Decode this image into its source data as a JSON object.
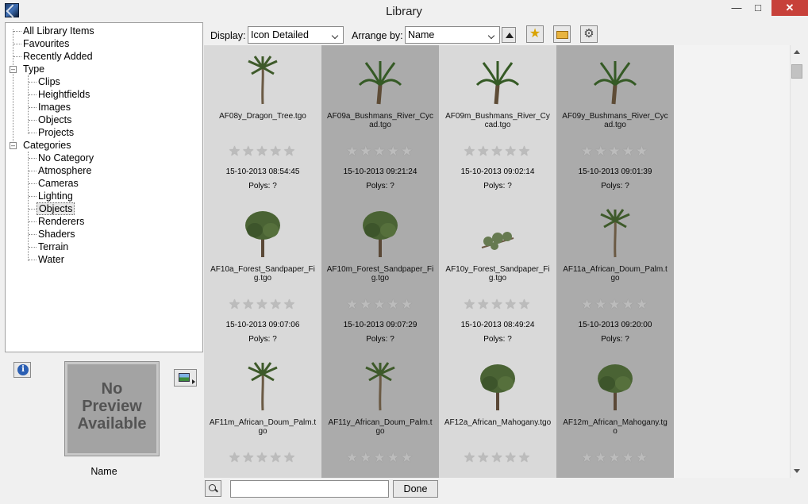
{
  "window": {
    "title": "Library"
  },
  "tree": {
    "items": [
      "All Library Items",
      "Favourites",
      "Recently Added",
      "Type",
      "Clips",
      "Heightfields",
      "Images",
      "Objects",
      "Projects",
      "Categories",
      "No Category",
      "Atmosphere",
      "Cameras",
      "Lighting",
      "Objects",
      "Renderers",
      "Shaders",
      "Terrain",
      "Water"
    ],
    "selected": "Objects"
  },
  "preview": {
    "text_line1": "No",
    "text_line2": "Preview",
    "text_line3": "Available",
    "name": "Name"
  },
  "toolbar": {
    "display_label": "Display:",
    "display_value": "Icon Detailed",
    "arrange_label": "Arrange by:",
    "arrange_value": "Name"
  },
  "grid": {
    "polys_text": "Polys: ?",
    "stars": "★★★★★",
    "items": [
      {
        "name": "AF08y_Dragon_Tree.tgo",
        "date": "15-10-2013 08:54:45"
      },
      {
        "name": "AF09a_Bushmans_River_Cycad.tgo",
        "date": "15-10-2013 09:21:24"
      },
      {
        "name": "AF09m_Bushmans_River_Cycad.tgo",
        "date": "15-10-2013 09:02:14"
      },
      {
        "name": "AF09y_Bushmans_River_Cycad.tgo",
        "date": "15-10-2013 09:01:39"
      },
      {
        "name": "AF10a_Forest_Sandpaper_Fig.tgo",
        "date": "15-10-2013 09:07:06"
      },
      {
        "name": "AF10m_Forest_Sandpaper_Fig.tgo",
        "date": "15-10-2013 09:07:29"
      },
      {
        "name": "AF10y_Forest_Sandpaper_Fig.tgo",
        "date": "15-10-2013 08:49:24"
      },
      {
        "name": "AF11a_African_Doum_Palm.tgo",
        "date": "15-10-2013 09:20:00"
      },
      {
        "name": "AF11m_African_Doum_Palm.tgo",
        "date": ""
      },
      {
        "name": "AF11y_African_Doum_Palm.tgo",
        "date": ""
      },
      {
        "name": "AF12a_African_Mahogany.tgo",
        "date": ""
      },
      {
        "name": "AF12m_African_Mahogany.tgo",
        "date": ""
      }
    ]
  },
  "bottom": {
    "search_value": "",
    "done_label": "Done"
  },
  "colors": {
    "light_column": "#d9d9d9",
    "dark_column": "#ababab",
    "close_button": "#c7413a"
  }
}
